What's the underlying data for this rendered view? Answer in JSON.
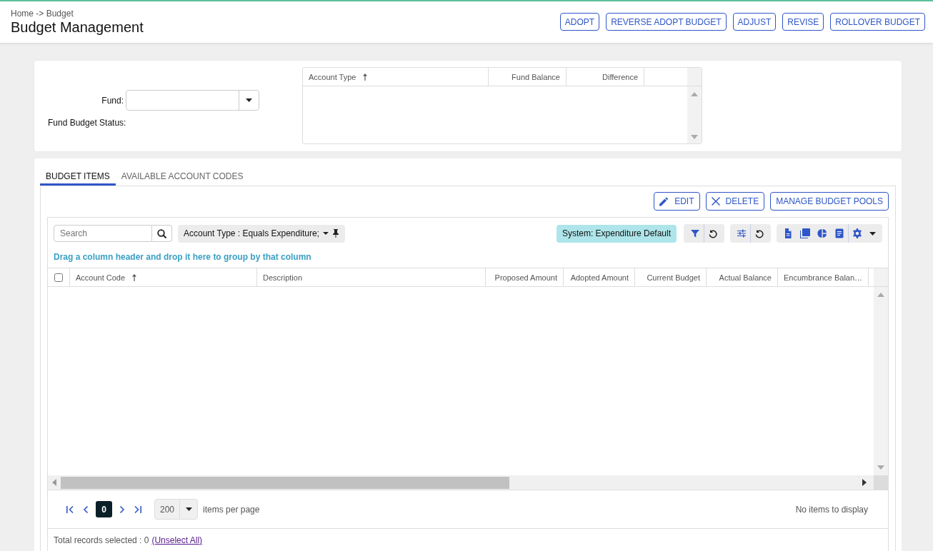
{
  "breadcrumb": "Home -> Budget",
  "title": "Budget Management",
  "header_buttons": [
    "ADOPT",
    "REVERSE ADOPT BUDGET",
    "ADJUST",
    "REVISE",
    "ROLLOVER BUDGET"
  ],
  "fund_form": {
    "fund_label": "Fund:",
    "status_label": "Fund Budget Status:"
  },
  "summary_grid": {
    "columns": [
      {
        "label": "Account Type",
        "sorted_ascending": true
      },
      {
        "label": "Fund Balance",
        "sorted_ascending": false
      },
      {
        "label": "Difference",
        "sorted_ascending": false
      }
    ]
  },
  "tabs": [
    {
      "label": "BUDGET ITEMS",
      "selected": true
    },
    {
      "label": "AVAILABLE ACCOUNT CODES",
      "selected": false
    }
  ],
  "actions": [
    {
      "label": "EDIT",
      "kind": "edit"
    },
    {
      "label": "DELETE",
      "kind": "delete"
    },
    {
      "label": "MANAGE BUDGET POOLS",
      "kind": "plain"
    }
  ],
  "grid": {
    "search_placeholder": "Search",
    "filter_chip": "Account Type : Equals Expenditure;",
    "view_chip": "System: Expenditure Default",
    "group_hint": "Drag a column header and drop it here to group by that column",
    "select_all_checked": false,
    "columns": [
      {
        "label": "Account Code",
        "sorted_ascending": true
      },
      {
        "label": "Description",
        "sorted_ascending": false
      },
      {
        "label": "Proposed Amount",
        "sorted_ascending": false
      },
      {
        "label": "Adopted Amount",
        "sorted_ascending": false
      },
      {
        "label": "Current Budget",
        "sorted_ascending": false
      },
      {
        "label": "Actual Balance",
        "sorted_ascending": false
      },
      {
        "label": "Encumbrance Balan…",
        "sorted_ascending": false
      }
    ]
  },
  "pager": {
    "page": "0",
    "page_size": "200",
    "page_size_label": "items per page",
    "status": "No items to display"
  },
  "footer": {
    "text": "Total records selected : 0",
    "link": "(Unselect All)"
  }
}
